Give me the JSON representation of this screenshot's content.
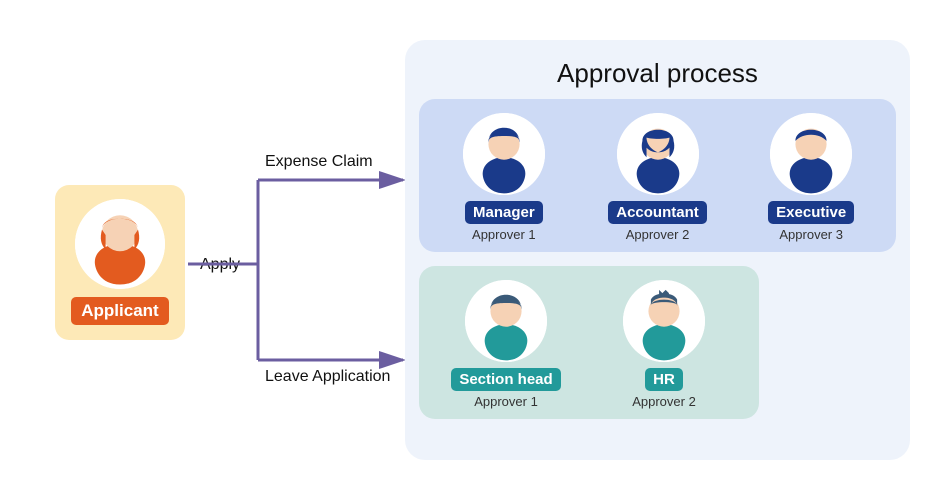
{
  "applicant": {
    "role": "Applicant"
  },
  "flow": {
    "apply": "Apply",
    "expense": "Expense Claim",
    "leave": "Leave Application"
  },
  "process": {
    "title": "Approval process",
    "expense_group": [
      {
        "role": "Manager",
        "sub": "Approver 1"
      },
      {
        "role": "Accountant",
        "sub": "Approver 2"
      },
      {
        "role": "Executive",
        "sub": "Approver 3"
      }
    ],
    "leave_group": [
      {
        "role": "Section head",
        "sub": "Approver 1"
      },
      {
        "role": "HR",
        "sub": "Approver 2"
      }
    ]
  },
  "colors": {
    "applicant_bg": "#fde9b7",
    "badge_orange": "#e35b1f",
    "badge_blue": "#1a3a8a",
    "badge_teal": "#229a9a",
    "panel_bg": "#eef3fb",
    "group_blue": "#cddaf5",
    "group_teal": "#cde5e1",
    "arrow": "#6b5ea0"
  }
}
